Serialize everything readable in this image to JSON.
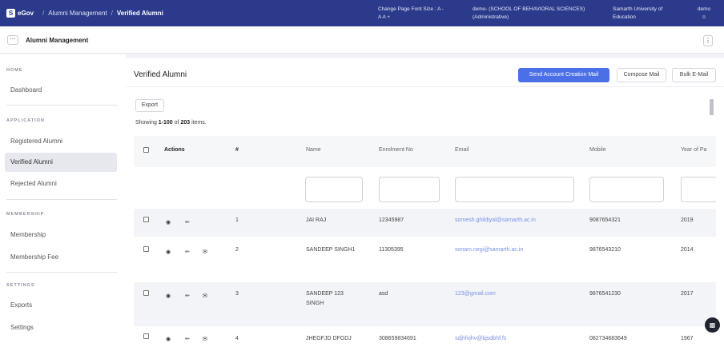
{
  "topbar": {
    "logo_letter": "S",
    "app_name": "eGov",
    "breadcrumbs": [
      "Alumni Management",
      "Verified Alumni"
    ],
    "font_size_label": "Change Page Font Size :",
    "font_size_options": [
      "A -",
      "A",
      "A +"
    ],
    "user_role_line1": "demo- (SCHOOL OF BEHAVIORAL SCIENCES)",
    "user_role_line2": "(Administrative)",
    "university_line1": "Samarth University of",
    "university_line2": "Education",
    "account_name": "demo",
    "account_icon": "user-icon",
    "background_color": "#2b3a8a"
  },
  "subbar": {
    "menu_icon": "more-horizontal-icon",
    "title": "Alumni Management",
    "kebab_icon": "more-vertical-icon"
  },
  "sidebar": {
    "sections": [
      {
        "label": "HOME",
        "items": [
          "Dashboard"
        ]
      },
      {
        "label": "APPLICATION",
        "items": [
          "Registered Alumni",
          "Verified Alumni",
          "Rejected Alumni"
        ]
      },
      {
        "label": "MEMBERSHIP",
        "items": [
          "Membership",
          "Membership Fee"
        ]
      },
      {
        "label": "SETTINGS",
        "items": [
          "Exports",
          "Settings"
        ]
      }
    ],
    "active_item": "Verified Alumni"
  },
  "main": {
    "heading": "Verified Alumni",
    "buttons": {
      "send_account_creation_mail": "Send Account Creation Mail",
      "compose_mail": "Compose Mail",
      "bulk_email": "Bulk E-Mail"
    },
    "export_label": "Export",
    "summary": {
      "prefix": "Showing ",
      "range": "1-100",
      "middle": " of ",
      "total": "203",
      "suffix": " items."
    },
    "accent_color": "#4b6fe7",
    "link_color": "#7b90e8"
  },
  "table": {
    "columns": [
      "Actions",
      "#",
      "Name",
      "Enrolment No",
      "Email",
      "Mobile",
      "Year of Pa"
    ],
    "rows": [
      {
        "num": "1",
        "name": "JAI RAJ",
        "enrolment": "12345987",
        "email": "somesh.ghildiyal@samarth.ac.in",
        "mobile": "9087654321",
        "year": "2019",
        "has_mail": false
      },
      {
        "num": "2",
        "name": "SANDEEP SINGH1",
        "enrolment": "11305395",
        "email": "sonam.negi@samarth.ac.in",
        "mobile": "9876543210",
        "year": "2014",
        "has_mail": true
      },
      {
        "num": "3",
        "name_line1": "SANDEEP 123",
        "name_line2": "SINGH",
        "enrolment": "asd",
        "email": "123@gmail.com",
        "mobile": "9876541230",
        "year": "2017",
        "has_mail": true
      },
      {
        "num": "4",
        "name": "JHEGFJD DFGDJ",
        "enrolment": "308659834691",
        "email": "sdjhfvjhv@bjsdbhf.fs",
        "mobile": "082734683649",
        "year": "1967",
        "has_mail": true
      }
    ],
    "action_icons": [
      "view-icon",
      "edit-icon",
      "mail-icon"
    ]
  },
  "chat_icon": "chat-icon"
}
